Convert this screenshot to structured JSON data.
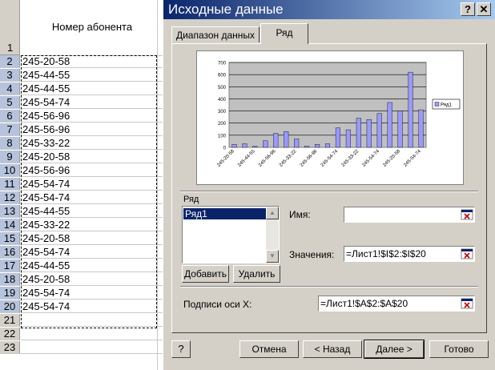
{
  "sheet": {
    "header_row_number": "1",
    "header": "Номер абонента",
    "rows": [
      {
        "n": "2",
        "v": "245-20-58"
      },
      {
        "n": "3",
        "v": "245-44-55"
      },
      {
        "n": "4",
        "v": "245-44-55"
      },
      {
        "n": "5",
        "v": "245-54-74"
      },
      {
        "n": "6",
        "v": "245-56-96"
      },
      {
        "n": "7",
        "v": "245-56-96"
      },
      {
        "n": "8",
        "v": "245-33-22"
      },
      {
        "n": "9",
        "v": "245-20-58"
      },
      {
        "n": "10",
        "v": "245-56-96"
      },
      {
        "n": "11",
        "v": "245-54-74"
      },
      {
        "n": "12",
        "v": "245-54-74"
      },
      {
        "n": "13",
        "v": "245-44-55"
      },
      {
        "n": "14",
        "v": "245-33-22"
      },
      {
        "n": "15",
        "v": "245-20-58"
      },
      {
        "n": "16",
        "v": "245-54-74"
      },
      {
        "n": "17",
        "v": "245-44-55"
      },
      {
        "n": "18",
        "v": "245-20-58"
      },
      {
        "n": "19",
        "v": "245-54-74"
      },
      {
        "n": "20",
        "v": "245-54-74"
      },
      {
        "n": "21",
        "v": ""
      },
      {
        "n": "22",
        "v": ""
      },
      {
        "n": "23",
        "v": ""
      }
    ]
  },
  "dialog": {
    "title": "Исходные данные",
    "help_glyph": "?",
    "close_glyph": "✕",
    "tabs": [
      "Диапазон данных",
      "Ряд"
    ],
    "series_group_label": "Ряд",
    "series_list": [
      "Ряд1"
    ],
    "name_label": "Имя:",
    "name_value": "",
    "values_label": "Значения:",
    "values_value": "=Лист1!$I$2:$I$20",
    "add_label": "Добавить",
    "delete_label": "Удалить",
    "xlabels_label": "Подписи оси X:",
    "xlabels_value": "=Лист1!$A$2:$A$20",
    "buttons": {
      "cancel": "Отмена",
      "back": "< Назад",
      "next": "Далее >",
      "finish": "Готово"
    },
    "help_icon_glyph": "?"
  },
  "chart_data": {
    "type": "bar",
    "categories": [
      "245-20-58",
      "245-44-55",
      "245-44-55",
      "245-54-74",
      "245-56-96",
      "245-56-96",
      "245-33-22",
      "245-20-58",
      "245-56-96",
      "245-54-74",
      "245-54-74",
      "245-44-55",
      "245-33-22",
      "245-20-58",
      "245-54-74",
      "245-44-55",
      "245-20-58",
      "245-54-74",
      "245-54-74"
    ],
    "tick_labels": [
      "245-20-58",
      "245-44-55",
      "245-56-96",
      "245-33-22",
      "245-56-96",
      "245-54-74",
      "245-33-22",
      "245-54-74",
      "245-20-58",
      "245-54-74"
    ],
    "series": [
      {
        "name": "Ряд1",
        "values": [
          25,
          30,
          10,
          55,
          115,
          130,
          70,
          10,
          25,
          30,
          160,
          145,
          240,
          230,
          280,
          370,
          300,
          620,
          310
        ]
      }
    ],
    "ylim": [
      0,
      700
    ],
    "yticks": [
      0,
      100,
      200,
      300,
      400,
      500,
      600,
      700
    ],
    "grid": true,
    "legend": "right",
    "bar_color": "#9999ff",
    "plot_bg": "#c0c0c0"
  }
}
